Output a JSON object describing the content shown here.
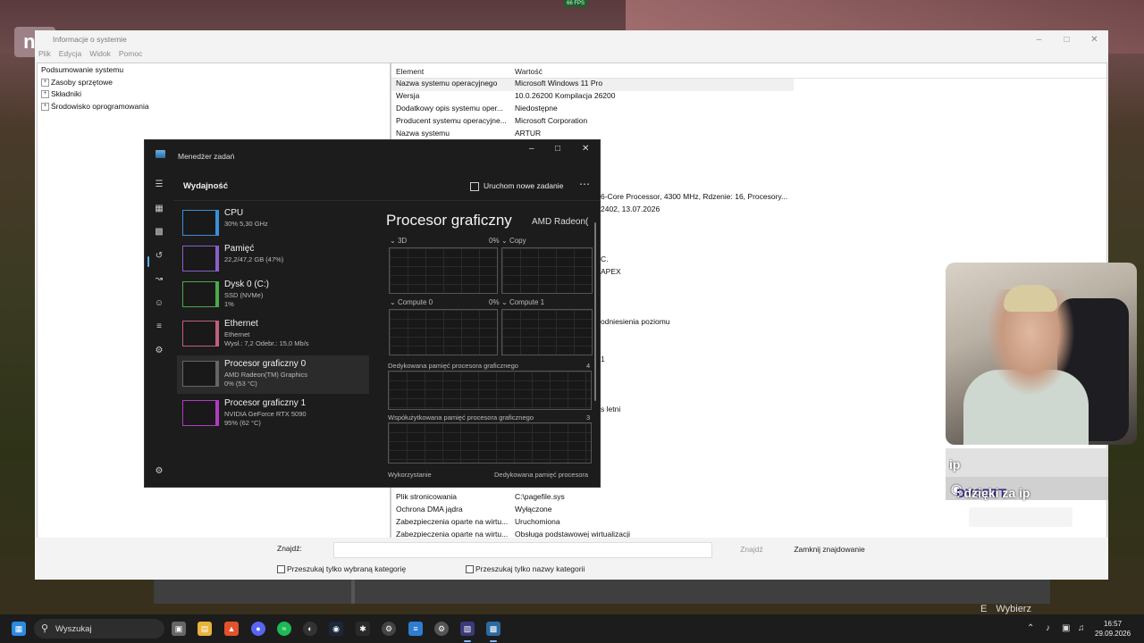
{
  "overlay": {
    "fps": "66 FPS",
    "logo": "n0"
  },
  "sysinfo": {
    "title": "Informacje o systemie",
    "menu": [
      "Plik",
      "Edycja",
      "Widok",
      "Pomoc"
    ],
    "tree": [
      {
        "label": "Podsumowanie systemu",
        "expander": ""
      },
      {
        "label": "Zasoby sprzętowe",
        "expander": "+"
      },
      {
        "label": "Składniki",
        "expander": "+"
      },
      {
        "label": "Środowisko oprogramowania",
        "expander": "+"
      }
    ],
    "columns": [
      "Element",
      "Wartość"
    ],
    "rows": [
      {
        "element": "Nazwa systemu operacyjnego",
        "value": "Microsoft Windows 11 Pro"
      },
      {
        "element": "Wersja",
        "value": "10.0.26200 Kompilacja 26200"
      },
      {
        "element": "Dodatkowy opis systemu oper...",
        "value": "Niedostępne"
      },
      {
        "element": "Producent systemu operacyjne...",
        "value": "Microsoft Corporation"
      },
      {
        "element": "Nazwa systemu",
        "value": "ARTUR"
      }
    ],
    "fragments": [
      "6-Core Processor, 4300 MHz, Rdzenie: 16, Procesory...",
      "2402, 13.07.2026",
      "C.",
      "APEX",
      "odniesienia poziomu",
      "1",
      "s letni"
    ],
    "bottom_rows": [
      {
        "element": "Plik stronicowania",
        "value": "C:\\pagefile.sys"
      },
      {
        "element": "Ochrona DMA jądra",
        "value": "Wyłączone"
      },
      {
        "element": "Zabezpieczenia oparte na wirtu...",
        "value": "Uruchomiona"
      },
      {
        "element": "Zabezpieczenia oparte na wirtu...",
        "value": "Obsługa podstawowej wirtualizacji"
      }
    ],
    "find": {
      "label": "Znajdź:",
      "value": "",
      "find_button": "Znajdź",
      "close_button": "Zamknij znajdowanie",
      "check1": "Przeszukaj tylko wybraną kategorię",
      "check2": "Przeszukaj tylko nazwy kategorii"
    }
  },
  "taskmgr": {
    "title": "Menedżer zadań",
    "heading": "Wydajność",
    "new_task": "Uruchom nowe zadanie",
    "resources": [
      {
        "name": "CPU",
        "sub1": "30%  5,30 GHz",
        "sub2": "",
        "color": "#3a8fd8"
      },
      {
        "name": "Pamięć",
        "sub1": "22,2/47,2 GB (47%)",
        "sub2": "",
        "color": "#8a5fc8"
      },
      {
        "name": "Dysk 0 (C:)",
        "sub1": "SSD (NVMe)",
        "sub2": "1%",
        "color": "#4ca94c"
      },
      {
        "name": "Ethernet",
        "sub1": "Ethernet",
        "sub2": "Wysł.: 7,2  Odebr.: 15,0 Mb/s",
        "color": "#c0607a"
      },
      {
        "name": "Procesor graficzny 0",
        "sub1": "AMD Radeon(TM) Graphics",
        "sub2": "0%  (53 °C)",
        "color": "#666666"
      },
      {
        "name": "Procesor graficzny 1",
        "sub1": "NVIDIA GeForce RTX 5090",
        "sub2": "95%  (62 °C)",
        "color": "#b03cc0"
      }
    ],
    "gpu_title": "Procesor graficzny",
    "gpu_name": "AMD Radeon(",
    "engines": [
      {
        "label": "3D",
        "pct": "0%"
      },
      {
        "label": "Copy",
        "pct": ""
      },
      {
        "label": "Compute 0",
        "pct": "0%"
      },
      {
        "label": "Compute 1",
        "pct": ""
      }
    ],
    "dedicated_label": "Dedykowana pamięć procesora graficznego",
    "dedicated_val": "4",
    "shared_label": "Współużytkowana pamięć procesora graficznego",
    "shared_val": "3",
    "footer_left": "Wykorzystanie",
    "footer_right": "Dedykowana pamięć procesora"
  },
  "chat": {
    "line1": "ip",
    "user": "DVSRTT",
    "message": ": dzięki za ip"
  },
  "bottom_hint": {
    "key": "E",
    "label": "Wybierz"
  },
  "taskbar": {
    "search": "Wyszukaj",
    "time": "16:57",
    "date": "29.09.2026"
  }
}
